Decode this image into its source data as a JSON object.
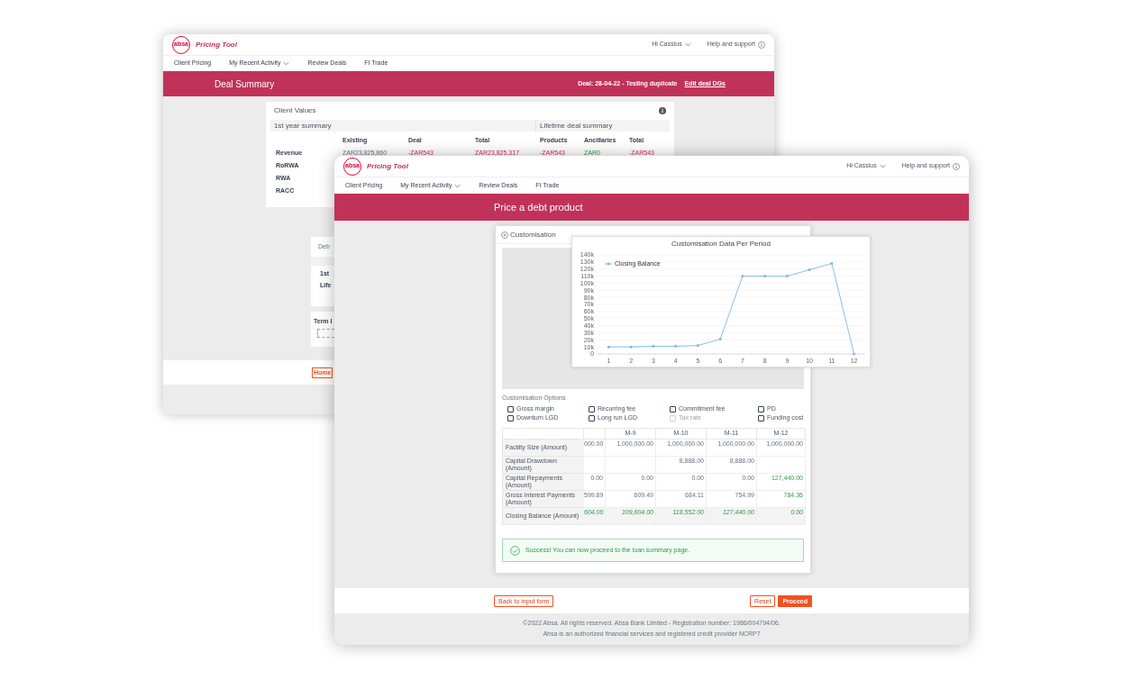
{
  "back_window": {
    "header": {
      "logo": "absa",
      "app_name": "Pricing Tool",
      "greeting": "Hi Cassius",
      "help": "Help and support"
    },
    "nav": [
      {
        "label": "Client Pricing",
        "dropdown": false
      },
      {
        "label": "My Recent Activity",
        "dropdown": true
      },
      {
        "label": "Review Deals",
        "dropdown": false
      },
      {
        "label": "FI Trade",
        "dropdown": false
      }
    ],
    "banner": {
      "title": "Deal Summary",
      "deal": "Deal: 28-04-22 - Testing duplicate",
      "link": "Edit deal DGs"
    },
    "client_values": {
      "title": "Client Values",
      "first_year_heading": "1st year summary",
      "lifetime_heading": "Lifetime deal summary",
      "columns": [
        "Existing",
        "Deal",
        "Total",
        "Products",
        "Ancillaries",
        "Total"
      ],
      "rows": [
        {
          "label": "Revenue",
          "values": [
            {
              "text": "ZAR23,825,860",
              "kind": "neutral"
            },
            {
              "text": "-ZAR543",
              "kind": "negative"
            },
            {
              "text": "ZAR23,825,317",
              "kind": "negative"
            },
            {
              "text": "-ZAR543",
              "kind": "negative"
            },
            {
              "text": "ZAR0",
              "kind": "positive"
            },
            {
              "text": "-ZAR543",
              "kind": "negative"
            }
          ]
        },
        {
          "label": "RoRWA"
        },
        {
          "label": "RWA"
        },
        {
          "label": "RACC"
        }
      ]
    },
    "partial": {
      "card_title": "Deb",
      "rows": [
        "1st",
        "Life"
      ],
      "field_label": "Term l",
      "home_button": "Home"
    }
  },
  "front_window": {
    "header": {
      "logo": "absa",
      "app_name": "Pricing Tool",
      "greeting": "Hi Cassius",
      "help": "Help and support"
    },
    "nav": [
      {
        "label": "Client Pricing",
        "dropdown": false
      },
      {
        "label": "My Recent Activity",
        "dropdown": true
      },
      {
        "label": "Review Deals",
        "dropdown": false
      },
      {
        "label": "FI Trade",
        "dropdown": false
      }
    ],
    "banner": {
      "title": "Price a debt product"
    },
    "section_title": "Customisation",
    "chart_data": {
      "type": "line",
      "title": "Customisation Data Per Period",
      "categories": [
        "1",
        "2",
        "3",
        "4",
        "5",
        "6",
        "7",
        "8",
        "9",
        "10",
        "11",
        "12"
      ],
      "series": [
        {
          "name": "Closing Balance",
          "color": "#7cb5ec",
          "values": [
            10000,
            10000,
            11000,
            11000,
            12000,
            21000,
            110000,
            110000,
            110000,
            119000,
            128000,
            0
          ]
        }
      ],
      "ylim": [
        0,
        140000
      ],
      "grid": true,
      "yticks": [
        {
          "value": 0,
          "label": "0"
        },
        {
          "value": 10000,
          "label": "10k"
        },
        {
          "value": 20000,
          "label": "20k"
        },
        {
          "value": 30000,
          "label": "30k"
        },
        {
          "value": 40000,
          "label": "40k"
        },
        {
          "value": 50000,
          "label": "50k"
        },
        {
          "value": 60000,
          "label": "60k"
        },
        {
          "value": 70000,
          "label": "70k"
        },
        {
          "value": 80000,
          "label": "80k"
        },
        {
          "value": 90000,
          "label": "90k"
        },
        {
          "value": 100000,
          "label": "100k"
        },
        {
          "value": 110000,
          "label": "110k"
        },
        {
          "value": 120000,
          "label": "120k"
        },
        {
          "value": 130000,
          "label": "130k"
        },
        {
          "value": 140000,
          "label": "140k"
        }
      ]
    },
    "options_title": "Customisation Options",
    "options": [
      {
        "label": "Gross margin",
        "checked": false,
        "disabled": false
      },
      {
        "label": "Recurring fee",
        "checked": false,
        "disabled": false
      },
      {
        "label": "Commitment fee",
        "checked": false,
        "disabled": false
      },
      {
        "label": "PD",
        "checked": false,
        "disabled": false
      },
      {
        "label": "Downturn LGD",
        "checked": false,
        "disabled": false
      },
      {
        "label": "Long run LGD",
        "checked": false,
        "disabled": false
      },
      {
        "label": "Tax rate",
        "checked": false,
        "disabled": true
      },
      {
        "label": "Funding cost",
        "checked": false,
        "disabled": false
      }
    ],
    "table": {
      "columns": [
        null,
        null,
        "M-9",
        "M-10",
        "M-11",
        "M-12"
      ],
      "rows": [
        {
          "label": "Facility Size (Amount)",
          "kind": "plain",
          "cells": [
            "000.00",
            "1,000,000.00",
            "1,000,000.00",
            "1,000,000.00",
            "1,000,000.00"
          ],
          "highlight_last": false
        },
        {
          "label": "Capital Drawdown (Amount)",
          "kind": "plain",
          "cells": [
            null,
            null,
            "8,888.00",
            "8,888.00",
            null
          ]
        },
        {
          "label": "Capital Repayments (Amount)",
          "kind": "plain",
          "cells": [
            "0.00",
            "0.00",
            "0.00",
            "0.00",
            "127,440.00"
          ],
          "highlight_last": true
        },
        {
          "label": "Gross Interest Payments (Amount)",
          "kind": "plain",
          "cells": [
            "599.89",
            "609.49",
            "684.11",
            "754.99",
            "784.36"
          ],
          "highlight_last": true
        },
        {
          "label": "Closing Balance (Amount)",
          "kind": "total",
          "cells": [
            "604.00",
            "109,604.00",
            "118,552.00",
            "127,440.00",
            "0.00"
          ]
        }
      ]
    },
    "alert": "Success! You can now proceed to the loan summary page.",
    "back_button": "Back to input form",
    "reset_button": "Reset",
    "proceed_button": "Proceed",
    "footer": [
      "©2022 Absa. All rights reserved. Absa Bank Limited - Registration number: 1986/004794/06.",
      "Absa is an authorized financial services and registered credit provider NCRP7"
    ]
  }
}
